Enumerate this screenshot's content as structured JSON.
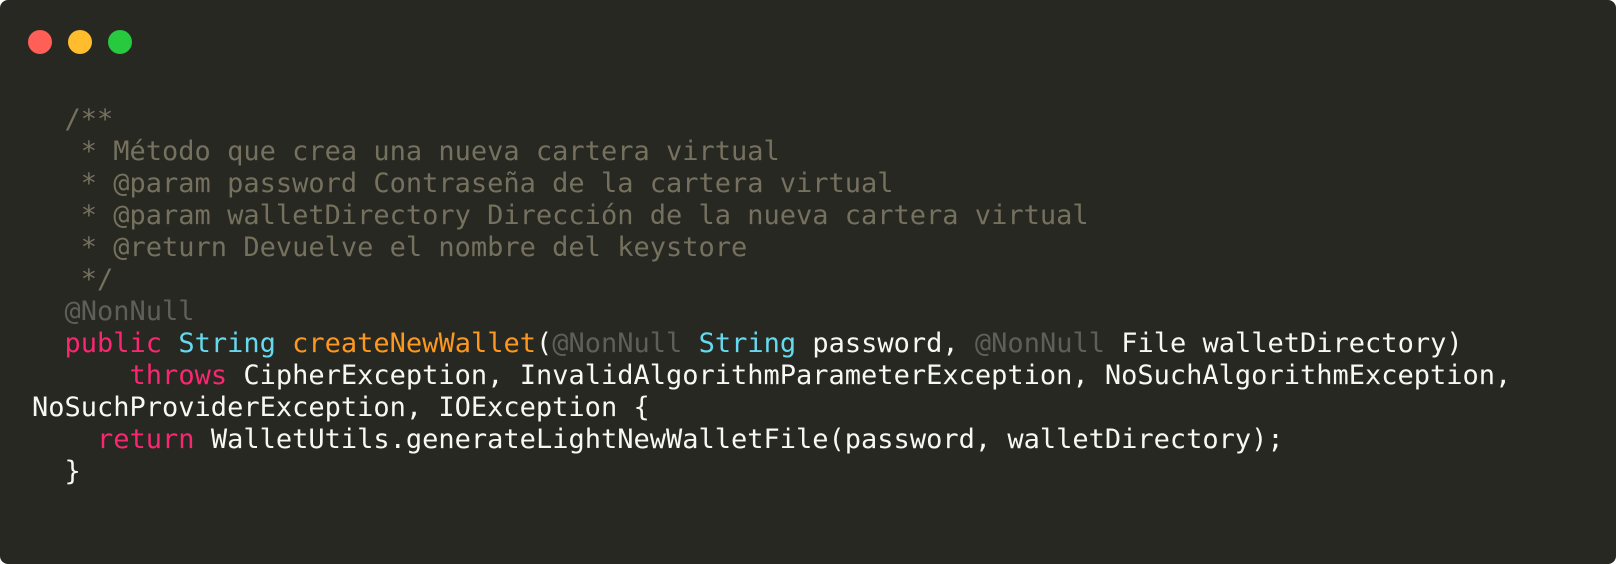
{
  "window": {
    "traffic_lights": [
      {
        "name": "close",
        "color": "#ff5f56"
      },
      {
        "name": "minimize",
        "color": "#ffbd2e"
      },
      {
        "name": "maximize",
        "color": "#27c93f"
      }
    ]
  },
  "theme": {
    "background": "#272822",
    "comment": "#75715e",
    "annotation": "#5f5f5a",
    "keyword": "#f92672",
    "type": "#66d9ef",
    "function": "#fd971f",
    "plain": "#f8f8f2"
  },
  "code": {
    "lines": [
      [
        {
          "t": "  /**",
          "k": "comment"
        }
      ],
      [
        {
          "t": "   * Método que crea una nueva cartera virtual",
          "k": "comment"
        }
      ],
      [
        {
          "t": "   * @param password Contraseña de la cartera virtual",
          "k": "comment"
        }
      ],
      [
        {
          "t": "   * @param walletDirectory Dirección de la nueva cartera virtual",
          "k": "comment"
        }
      ],
      [
        {
          "t": "   * @return Devuelve el nombre del keystore",
          "k": "comment"
        }
      ],
      [
        {
          "t": "   */",
          "k": "comment"
        }
      ],
      [
        {
          "t": "  @NonNull",
          "k": "annotation"
        }
      ],
      [
        {
          "t": "  ",
          "k": "plain"
        },
        {
          "t": "public",
          "k": "keyword"
        },
        {
          "t": " ",
          "k": "plain"
        },
        {
          "t": "String",
          "k": "type"
        },
        {
          "t": " ",
          "k": "plain"
        },
        {
          "t": "createNewWallet",
          "k": "func"
        },
        {
          "t": "(",
          "k": "plain"
        },
        {
          "t": "@NonNull",
          "k": "annotation"
        },
        {
          "t": " ",
          "k": "plain"
        },
        {
          "t": "String",
          "k": "type"
        },
        {
          "t": " password, ",
          "k": "plain"
        },
        {
          "t": "@NonNull",
          "k": "annotation"
        },
        {
          "t": " File walletDirectory)",
          "k": "plain"
        }
      ],
      [
        {
          "t": "      ",
          "k": "plain"
        },
        {
          "t": "throws",
          "k": "keyword"
        },
        {
          "t": " CipherException, InvalidAlgorithmParameterException, NoSuchAlgorithmException,",
          "k": "plain"
        }
      ],
      [
        {
          "t": "NoSuchProviderException, IOException {",
          "k": "plain"
        }
      ],
      [
        {
          "t": "    ",
          "k": "plain"
        },
        {
          "t": "return",
          "k": "keyword"
        },
        {
          "t": " WalletUtils.generateLightNewWalletFile(password, walletDirectory);",
          "k": "plain"
        }
      ],
      [
        {
          "t": "  }",
          "k": "plain"
        }
      ]
    ]
  }
}
